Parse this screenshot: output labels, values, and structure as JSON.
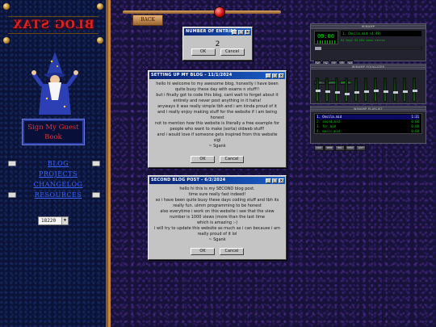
{
  "sidebar": {
    "logo_title": "BLOG STAX",
    "guestbook_label": "Sign My Guest Book",
    "nav": [
      "BLOG",
      "PROJECTS",
      "CHANGELOG",
      "RESOURCES"
    ],
    "counter_value": "18220"
  },
  "top": {
    "back_label": "BACK"
  },
  "entries_dialog": {
    "title": "NUMBER OF ENTRIES",
    "value": "2",
    "ok": "OK",
    "cancel": "Cancel"
  },
  "posts": [
    {
      "title": "SETTING UP MY BLOG - 11/1/2024",
      "lines": [
        "hello hi welcome to my awesome blog. honestly i have been",
        "quite busy these day with exams n stuff!!",
        "but i finally got to code this blog. cant wait to forget about it",
        "entirely and never post anything in it haha!",
        "anyways it was really simple tbh and i am kinda proud of it",
        "and i really enjoy making stuff for the website if i am being",
        "honest",
        "not to mention how this website is literally a free example for",
        "people who want to make (sorta) oldweb stuff!",
        "and i would love if someone gets inspired from this website",
        "sigl",
        "~ Sgank"
      ],
      "ok": "OK",
      "cancel": "Cancel"
    },
    {
      "title": "SECOND BLOG POST - 6/2/2024",
      "lines": [
        "hello hi this is my SECOND blog post.",
        "time sure really fast indeed!",
        "so i have been quite busy these days coding stuff and tbh its",
        "really fun. ulmm programming to be honest",
        "also everytime i work on this website i see that the view",
        "number is 1000 views (more than the last time",
        "which is amazing :-)",
        "i will try to update this website as much as i can because i am",
        "really proud of it lol",
        "~ Sgank"
      ],
      "ok": "OK",
      "cancel": "Cancel"
    }
  ],
  "winamp": {
    "main_title": "WINAMP",
    "time": "00:00",
    "song": "1. Onsila.mid (4:49)",
    "info": "64 kbps 44 kHz mono stereo",
    "seek": 0.0,
    "controls": [
      "|<",
      ">",
      "||",
      "[]",
      ">|"
    ],
    "eq_title": "WINAMP EQUALIZER",
    "eq_toggles": [
      "ON",
      "AUTO",
      "PRESETS"
    ],
    "eq_levels": [
      0.5,
      0.45,
      0.4,
      0.35,
      0.4,
      0.45,
      0.5,
      0.45,
      0.4,
      0.45,
      0.5
    ],
    "pl_title": "WINAMP PLAYLIST",
    "playlist": [
      {
        "name": "1. Onsila.mid",
        "dur": "1:31"
      },
      {
        "name": "2. sound.mid",
        "dur": "0:00"
      },
      {
        "name": "3. frr.mid",
        "dur": "0:00"
      },
      {
        "name": "4. music.mid",
        "dur": "0:00"
      }
    ],
    "pl_buttons": [
      "ADD",
      "REM",
      "SEL",
      "MISC",
      "LIST"
    ],
    "colors": {
      "lcd": "#00e000",
      "frame": "#23232f"
    }
  }
}
